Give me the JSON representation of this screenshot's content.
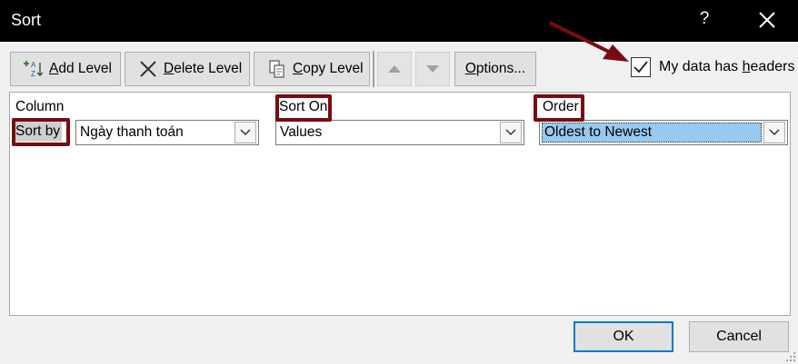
{
  "window": {
    "title": "Sort",
    "help_label": "?"
  },
  "toolbar": {
    "add_level": {
      "accel": "A",
      "rest": "dd Level"
    },
    "delete_level": {
      "accel": "D",
      "rest": "elete Level"
    },
    "copy_level": {
      "accel": "C",
      "rest": "opy Level"
    },
    "options": {
      "accel": "O",
      "rest": "ptions..."
    }
  },
  "headers_checkbox": {
    "label_pre": "My data has ",
    "label_accel": "h",
    "label_post": "eaders",
    "checked": true
  },
  "grid": {
    "columns": [
      "Column",
      "Sort On",
      "Order"
    ],
    "rows": [
      {
        "label": "Sort by",
        "column": "Ngày thanh toán",
        "sort_on": "Values",
        "order": "Oldest to Newest"
      }
    ]
  },
  "footer": {
    "ok": "OK",
    "cancel": "Cancel"
  },
  "colors": {
    "highlight": "#7a0b12",
    "selection": "#99c9ef",
    "focus": "#0078d7"
  }
}
